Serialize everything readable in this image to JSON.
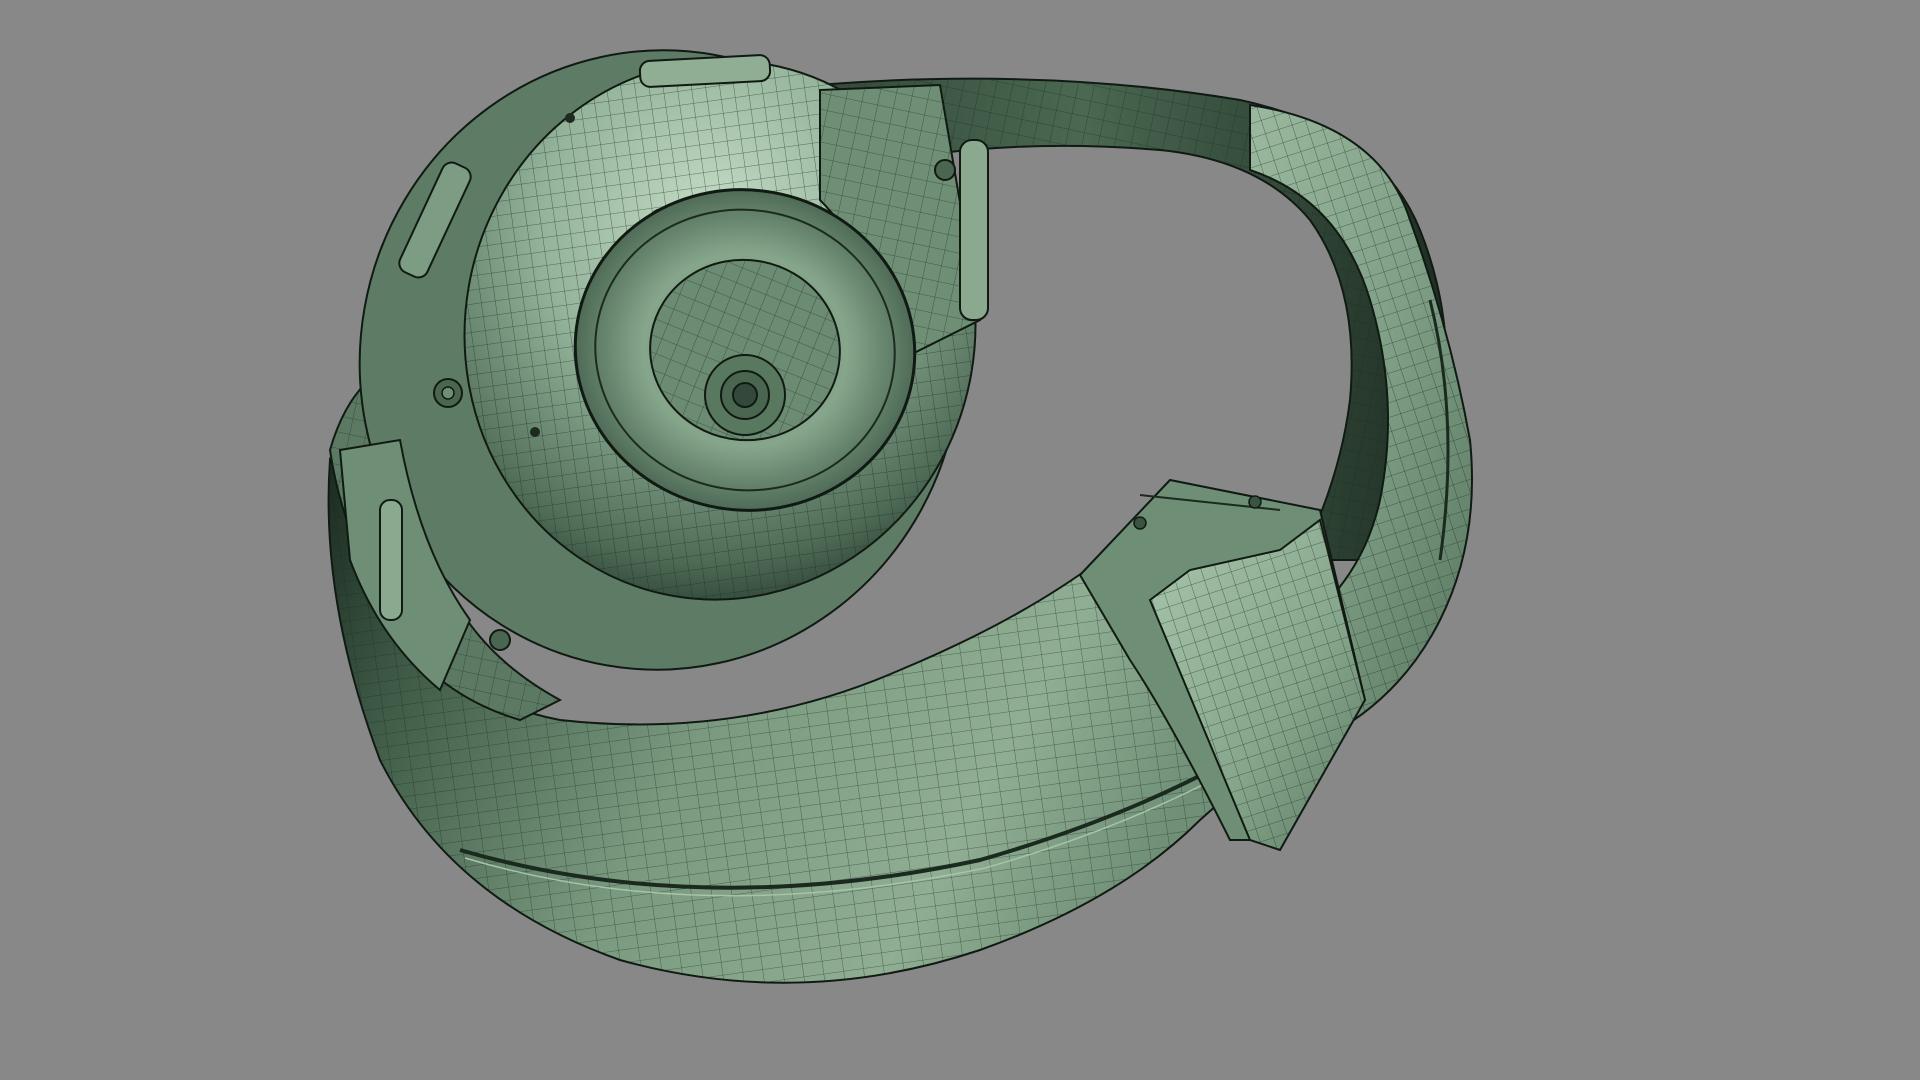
{
  "viewport": {
    "background_color": "#888888",
    "model_base_color": "#7d9a84",
    "model_highlight_color": "#b4d2b9",
    "model_shadow_color": "#18261c",
    "wire_color": "#1c2a20",
    "display_mode": "shaded-wireframe",
    "object": "smartwatch-with-strap",
    "view": "rear-perspective"
  }
}
